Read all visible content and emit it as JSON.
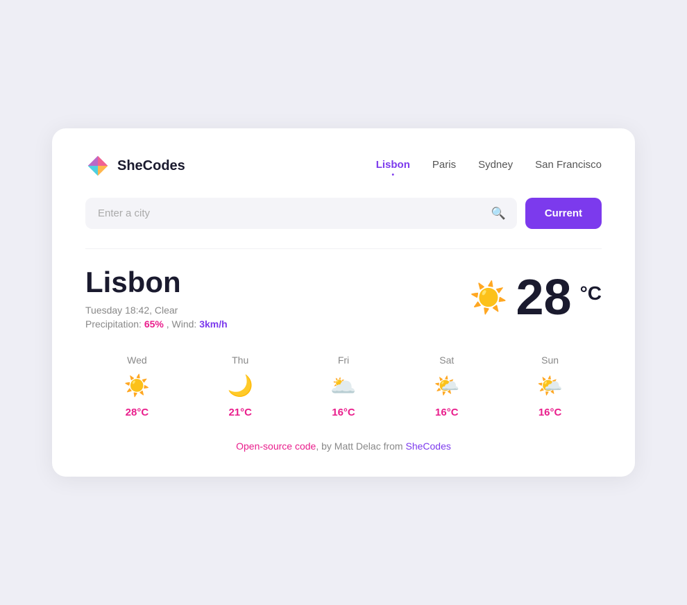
{
  "logo": {
    "text": "SheCodes"
  },
  "nav": {
    "items": [
      {
        "label": "Lisbon",
        "active": true
      },
      {
        "label": "Paris",
        "active": false
      },
      {
        "label": "Sydney",
        "active": false
      },
      {
        "label": "San Francisco",
        "active": false
      }
    ]
  },
  "search": {
    "placeholder": "Enter a city",
    "button_label": "Current"
  },
  "weather": {
    "city": "Lisbon",
    "day_time": "Tuesday 18:42, Clear",
    "precipitation_label": "Precipitation:",
    "precipitation_value": "65%",
    "wind_label": "Wind:",
    "wind_value": "3km/h",
    "temperature": "28",
    "unit": "°C"
  },
  "forecast": [
    {
      "day": "Wed",
      "icon": "☀",
      "temp": "28°C"
    },
    {
      "day": "Thu",
      "icon": "🌙",
      "temp": "21°C"
    },
    {
      "day": "Fri",
      "icon": "🌥",
      "temp": "16°C"
    },
    {
      "day": "Sat",
      "icon": "🌤",
      "temp": "16°C"
    },
    {
      "day": "Sun",
      "icon": "🌤",
      "temp": "16°C"
    }
  ],
  "footer": {
    "text1": "Open-source code",
    "text2": ", by ",
    "text3": "Matt Delac",
    "text4": " from ",
    "text5": "SheCodes"
  }
}
